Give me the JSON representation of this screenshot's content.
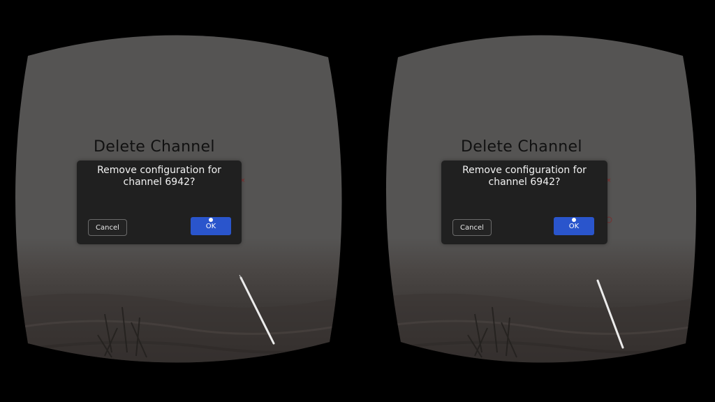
{
  "dialog": {
    "title": "Delete Channel",
    "message": "Remove configuration for channel 6942?",
    "cancel_label": "Cancel",
    "ok_label": "OK",
    "close_glyph": "×"
  },
  "colors": {
    "lens_gray": "#555453",
    "dialog_bg": "#202020",
    "ok_button": "#2a55cc",
    "background": "#000000"
  },
  "icons": {
    "close": "close-icon",
    "controller_pointer": "laser-pointer"
  }
}
